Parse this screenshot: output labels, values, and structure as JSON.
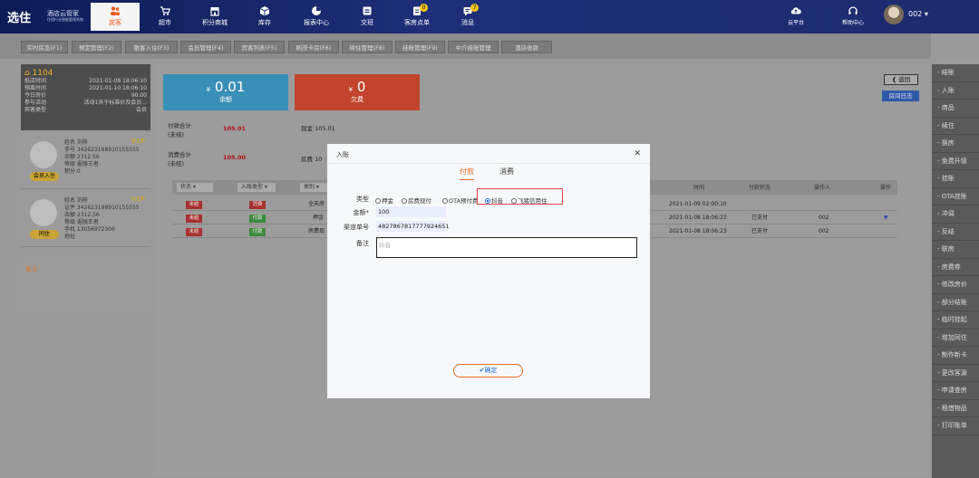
{
  "brand": {
    "name": "选住",
    "subtitle": "酒店云管家",
    "slogan": "住宿行业智能管理系统"
  },
  "nav": [
    {
      "label": "宾客",
      "icon": "guests-icon",
      "active": true
    },
    {
      "label": "超市",
      "icon": "cart-icon"
    },
    {
      "label": "积分商城",
      "icon": "store-icon"
    },
    {
      "label": "库存",
      "icon": "box-icon"
    },
    {
      "label": "报表中心",
      "icon": "chart-icon"
    },
    {
      "label": "交班",
      "icon": "shift-icon"
    },
    {
      "label": "客房点单",
      "icon": "order-icon",
      "badge": "0"
    },
    {
      "label": "消息",
      "icon": "message-icon",
      "badge": "7"
    }
  ],
  "topright": {
    "cloud": "云平台",
    "help": "帮助中心",
    "user": "002 ▾"
  },
  "tabs": [
    "实时房态(F1)",
    "预定管理(F2)",
    "散客入住(F3)",
    "会员管理(F4)",
    "宾客列表(F5)",
    "刷茂卡房(F6)",
    "续住管理(F8)",
    "挂账管理(F9)",
    "中介挂账管理",
    "酒店收款"
  ],
  "room": {
    "number": "1104",
    "rows": [
      {
        "k": "抵店时间",
        "v": "2021-01-08 18:06:10"
      },
      {
        "k": "预离时间",
        "v": "2021-01-10 18:06:10"
      },
      {
        "k": "今日房价",
        "v": "90.00"
      },
      {
        "k": "参与活动",
        "v": "活动1天于标准价及会员..."
      },
      {
        "k": "宾客类型",
        "v": "会员"
      }
    ]
  },
  "guests": [
    {
      "tag": "会员入住",
      "vip": "V1P",
      "lines": [
        "姓名 刘梓",
        "手号 342623198910155555",
        "余额 2312.56",
        "等级 倔强王者",
        "积分 0"
      ]
    },
    {
      "tag": "同住",
      "vip": "V1P",
      "lines": [
        "姓名 刘梓",
        "证件 342623198910155555",
        "余额 2312.56",
        "等级 倔强王者",
        "手机 13056972306",
        "地址"
      ]
    }
  ],
  "note_label": "备注:",
  "summary": {
    "balance_value": "0.01",
    "balance_label": "余额",
    "balance_currency": "¥",
    "owe_value": "0",
    "owe_label": "欠费",
    "owe_currency": "¥",
    "pay_total_label": "付款合计\n(未结)",
    "pay_total": "105.01",
    "pay_cash": "现金  105.01",
    "consume_label": "消费合计\n(未结)",
    "consume_total": "105.00",
    "consume_room": "房费  10"
  },
  "filters": {
    "status": "状态",
    "type": "入账类型",
    "cat": "类别",
    "time": "时间",
    "paystatus": "付款状态",
    "operator": "操作人",
    "action": "操作"
  },
  "rows": [
    {
      "status": "未结",
      "type": "消费",
      "cat": "全天房",
      "time": "2021-01-09 02:00:10",
      "pay": "",
      "op": ""
    },
    {
      "status": "未结",
      "type": "付款",
      "cat": "押金",
      "time": "2021-01-08 18:06:23",
      "pay": "已支付",
      "op": "002"
    },
    {
      "status": "未结",
      "type": "付款",
      "cat": "房费现",
      "time": "2021-01-08 18:06:23",
      "pay": "已支付",
      "op": "002"
    }
  ],
  "back": "返回",
  "log": "房间日志",
  "actions": [
    "- 结账",
    "- 入账",
    "- 商品",
    "- 续住",
    "- 换房",
    "- 免费升级",
    "- 挂账",
    "- OTA挂账",
    "- 冲调",
    "- 反结",
    "- 联房",
    "- 房费券",
    "- 修改房价",
    "- 部分结账",
    "- 临时挂起",
    "- 增加同住",
    "- 制作新卡",
    "- 更改客源",
    "- 申请查房",
    "- 租借物品",
    "- 打印账单"
  ],
  "modal": {
    "title": "入账",
    "tabs": [
      "付款",
      "消费"
    ],
    "type_label": "类型",
    "options": [
      "押金",
      "房费现付",
      "OTA预付费",
      "抖音",
      "飞猪信用住"
    ],
    "selected_option": "抖音",
    "amount_label": "金额*",
    "amount_value": "100",
    "channel_label": "渠道单号",
    "channel_value": "4827867817777924651",
    "remark_label": "备注",
    "remark_placeholder": "抖音",
    "confirm": "✔确定"
  }
}
